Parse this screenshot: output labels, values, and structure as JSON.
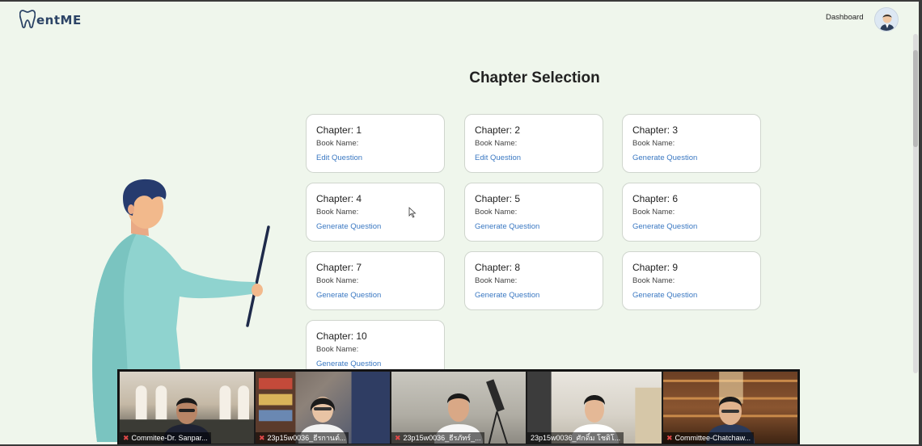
{
  "header": {
    "logo_text": "entME",
    "nav_dashboard": "Dashboard"
  },
  "page": {
    "title": "Chapter Selection"
  },
  "chapters": [
    {
      "title": "Chapter: 1",
      "book": "Book Name:",
      "action": "Edit Question"
    },
    {
      "title": "Chapter: 2",
      "book": "Book Name:",
      "action": "Edit Question"
    },
    {
      "title": "Chapter: 3",
      "book": "Book Name:",
      "action": "Generate Question"
    },
    {
      "title": "Chapter: 4",
      "book": "Book Name:",
      "action": "Generate Question"
    },
    {
      "title": "Chapter: 5",
      "book": "Book Name:",
      "action": "Generate Question"
    },
    {
      "title": "Chapter: 6",
      "book": "Book Name:",
      "action": "Generate Question"
    },
    {
      "title": "Chapter: 7",
      "book": "Book Name:",
      "action": "Generate Question"
    },
    {
      "title": "Chapter: 8",
      "book": "Book Name:",
      "action": "Generate Question"
    },
    {
      "title": "Chapter: 9",
      "book": "Book Name:",
      "action": "Generate Question"
    },
    {
      "title": "Chapter: 10",
      "book": "Book Name:",
      "action": "Generate Question"
    }
  ],
  "participants": [
    {
      "name": "Commitee-Dr. Sanpar..."
    },
    {
      "name": "23p15w0036_ธีรกานต์..."
    },
    {
      "name": "23p15w0036_ธีรภัทร์_..."
    },
    {
      "name": "23p15w0036_ศักดิ์ม โชติโ..."
    },
    {
      "name": "Committee-Chatchaw..."
    }
  ],
  "colors": {
    "page_bg": "#eff6ec",
    "link": "#3a78c2",
    "brand": "#2c4466"
  }
}
